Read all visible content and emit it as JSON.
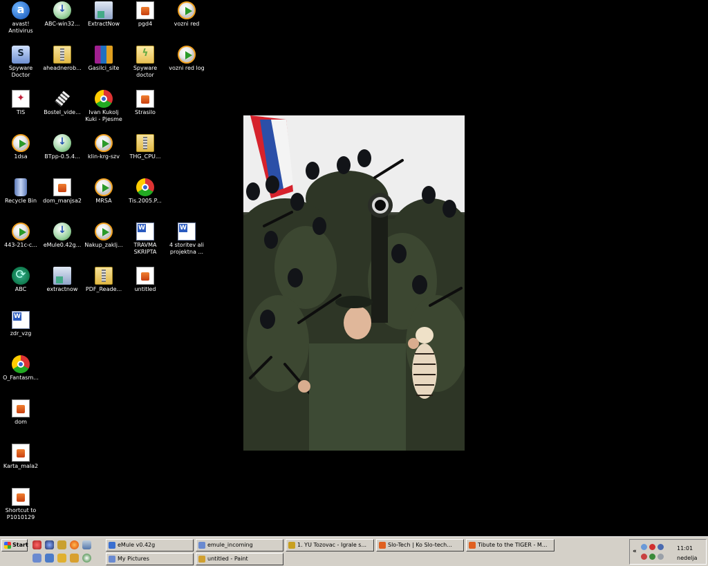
{
  "desktop": {
    "icons": [
      {
        "label": "avast!\nAntivirus",
        "icon": "avast-icon"
      },
      {
        "label": "ABC-win32...",
        "icon": "setup-icon"
      },
      {
        "label": "ExtractNow",
        "icon": "extract-icon"
      },
      {
        "label": "pgd4",
        "icon": "document-icon"
      },
      {
        "label": "vozni red",
        "icon": "media-icon"
      },
      {
        "label": "Spyware\nDoctor",
        "icon": "spyware-icon"
      },
      {
        "label": "aheadnerob...",
        "icon": "zip-folder-icon"
      },
      {
        "label": "Gasilci_site",
        "icon": "rar-icon"
      },
      {
        "label": "Spyware\ndoctor",
        "icon": "spyware-folder-icon"
      },
      {
        "label": "vozni red log",
        "icon": "media-icon"
      },
      {
        "label": "TIS",
        "icon": "tis-icon"
      },
      {
        "label": "Bostel_vide...",
        "icon": "film-icon"
      },
      {
        "label": "Ivan Kukolj\nKuki - Pjesme",
        "icon": "chrome-icon"
      },
      {
        "label": "Strasilo",
        "icon": "document-icon"
      },
      {
        "label": "1dsa",
        "icon": "media-icon"
      },
      {
        "label": "BTpp-0.5.4...",
        "icon": "setup-icon"
      },
      {
        "label": "klin-krg-szv",
        "icon": "media-icon"
      },
      {
        "label": "THG_CPU...",
        "icon": "zip-folder-icon"
      },
      {
        "label": "Recycle Bin",
        "icon": "recycle-bin-icon"
      },
      {
        "label": "dom_manjsa2",
        "icon": "document-icon"
      },
      {
        "label": "MRSA",
        "icon": "media-icon"
      },
      {
        "label": "Tis.2005.P...",
        "icon": "chrome-icon"
      },
      {
        "label": "443-21c-c...",
        "icon": "media-icon"
      },
      {
        "label": "eMule0.42g...",
        "icon": "setup-icon"
      },
      {
        "label": "Nakup_zaklj...",
        "icon": "media-icon"
      },
      {
        "label": "TRAVMA\nSKRIPTA",
        "icon": "word-icon"
      },
      {
        "label": "4 storitev ali\nprojektna ...",
        "icon": "word-icon"
      },
      {
        "label": "ABC",
        "icon": "abc-icon"
      },
      {
        "label": "extractnow",
        "icon": "extract-icon"
      },
      {
        "label": "PDF_Reade...",
        "icon": "zip-folder-icon"
      },
      {
        "label": "untitled",
        "icon": "document-icon"
      },
      {
        "label": "zdr_vzg",
        "icon": "word-icon"
      },
      {
        "label": "O_Fantasm...",
        "icon": "chrome-icon"
      },
      {
        "label": "dom",
        "icon": "document-icon"
      },
      {
        "label": "Karta_mala2",
        "icon": "document-icon"
      },
      {
        "label": "Shortcut to\nP1010129",
        "icon": "document-icon"
      }
    ]
  },
  "taskbar": {
    "start_label": "Start",
    "tasks": [
      {
        "label": "eMule v0.42g",
        "icon": "emule-icon",
        "color": "#3a6fd0"
      },
      {
        "label": "emule_incoming",
        "icon": "folder-icon",
        "color": "#6a8ad0"
      },
      {
        "label": "1. YU Tozovac - Igrale s...",
        "icon": "winamp-icon",
        "color": "#c8a020"
      },
      {
        "label": "Slo-Tech | Ko Slo-tech...",
        "icon": "firefox-icon",
        "color": "#e06020"
      },
      {
        "label": "Tibute to the TIGER - M...",
        "icon": "firefox-icon",
        "color": "#e06020"
      },
      {
        "label": "My Pictures",
        "icon": "folder-icon",
        "color": "#6a8ad0"
      },
      {
        "label": "untitled - Paint",
        "icon": "paint-icon",
        "color": "#d0a030"
      }
    ],
    "clock": {
      "time": "11:01",
      "day": "nedelja"
    }
  },
  "colors": {
    "desktop_bg": "#000000",
    "taskbar_bg": "#d4d0c8"
  }
}
